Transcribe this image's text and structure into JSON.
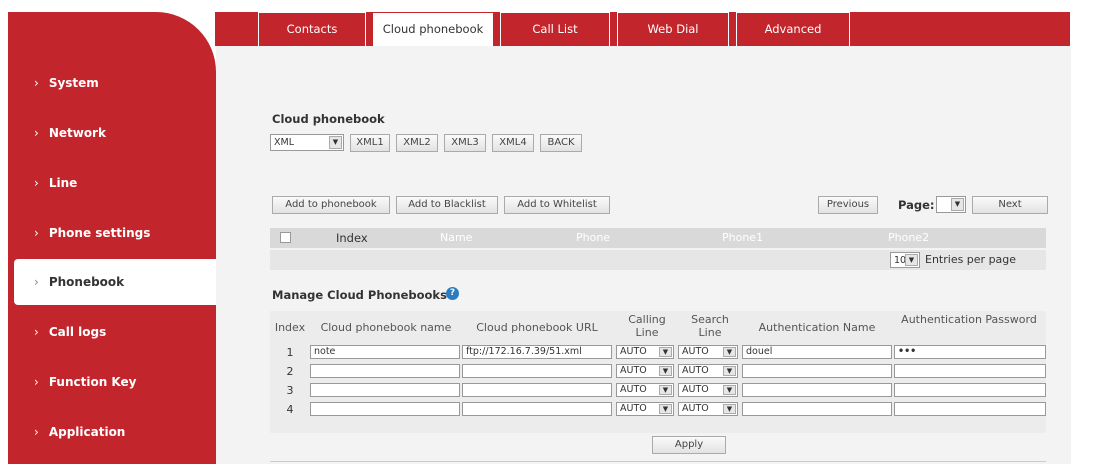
{
  "tabs": [
    {
      "label": "Contacts"
    },
    {
      "label": "Cloud phonebook"
    },
    {
      "label": "Call List"
    },
    {
      "label": "Web Dial"
    },
    {
      "label": "Advanced"
    }
  ],
  "sidebar": {
    "items": [
      {
        "label": "System"
      },
      {
        "label": "Network"
      },
      {
        "label": "Line"
      },
      {
        "label": "Phone settings"
      },
      {
        "label": "Phonebook"
      },
      {
        "label": "Call logs"
      },
      {
        "label": "Function Key"
      },
      {
        "label": "Application"
      }
    ],
    "chevron": "›"
  },
  "cloud": {
    "title": "Cloud phonebook",
    "select_value": "XML",
    "buttons": [
      "XML1",
      "XML2",
      "XML3",
      "XML4",
      "BACK"
    ]
  },
  "contacts": {
    "actions": [
      "Add to phonebook",
      "Add to Blacklist",
      "Add to Whitelist"
    ],
    "previous": "Previous",
    "page_label": "Page:",
    "next": "Next",
    "columns": [
      "Index",
      "Name",
      "Phone",
      "Phone1",
      "Phone2"
    ],
    "entries_value": "10",
    "entries_label": "Entries per page"
  },
  "manage": {
    "title": "Manage Cloud Phonebooks",
    "headers": {
      "index": "Index",
      "name": "Cloud phonebook name",
      "url": "Cloud phonebook URL",
      "calling": "Calling Line",
      "search": "Search Line",
      "auth_name": "Authentication Name",
      "auth_pwd": "Authentication Password"
    },
    "rows": [
      {
        "index": "1",
        "name": "note",
        "url": "ftp://172.16.7.39/51.xml",
        "calling": "AUTO",
        "search": "AUTO",
        "auth_name": "douel",
        "auth_pwd": "•••"
      },
      {
        "index": "2",
        "name": "",
        "url": "",
        "calling": "AUTO",
        "search": "AUTO",
        "auth_name": "",
        "auth_pwd": ""
      },
      {
        "index": "3",
        "name": "",
        "url": "",
        "calling": "AUTO",
        "search": "AUTO",
        "auth_name": "",
        "auth_pwd": ""
      },
      {
        "index": "4",
        "name": "",
        "url": "",
        "calling": "AUTO",
        "search": "AUTO",
        "auth_name": "",
        "auth_pwd": ""
      }
    ],
    "apply": "Apply"
  },
  "colors": {
    "brand": "#c2262c",
    "help": "#2a7bc0"
  }
}
